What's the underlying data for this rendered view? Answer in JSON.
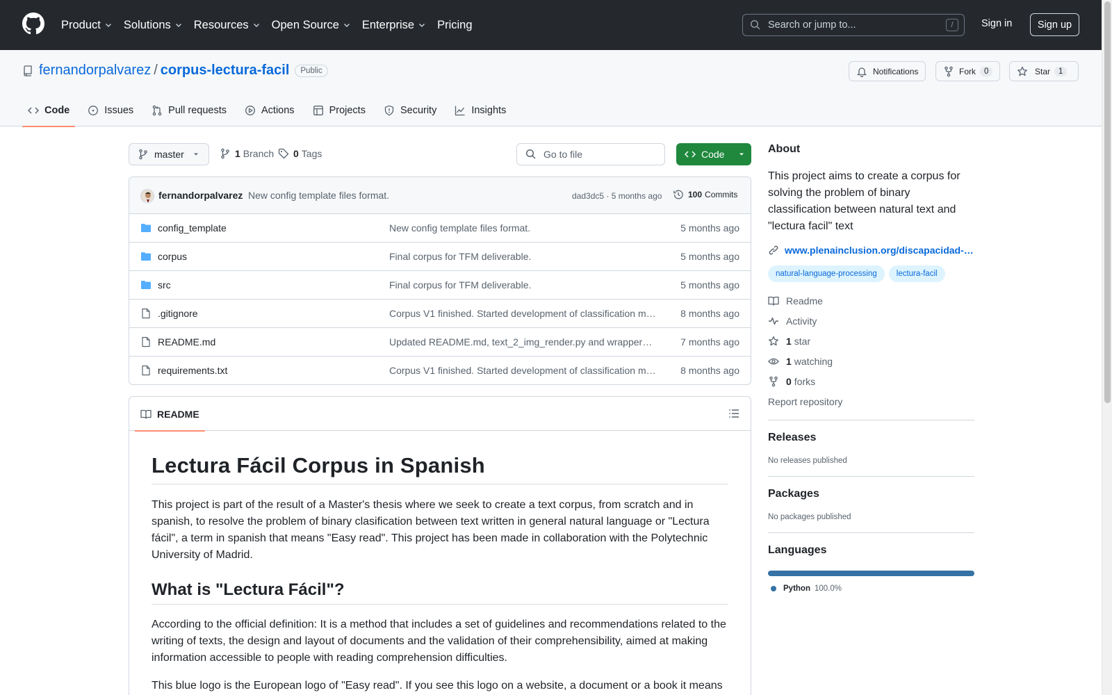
{
  "header": {
    "nav": [
      {
        "label": "Product",
        "has_chevron": true
      },
      {
        "label": "Solutions",
        "has_chevron": true
      },
      {
        "label": "Resources",
        "has_chevron": true
      },
      {
        "label": "Open Source",
        "has_chevron": true
      },
      {
        "label": "Enterprise",
        "has_chevron": true
      },
      {
        "label": "Pricing",
        "has_chevron": false
      }
    ],
    "search_placeholder": "Search or jump to...",
    "search_shortcut": "/",
    "signin": "Sign in",
    "signup": "Sign up"
  },
  "repo": {
    "owner": "fernandorpalvarez",
    "separator": "/",
    "name": "corpus-lectura-facil",
    "visibility": "Public",
    "notifications_label": "Notifications",
    "fork_label": "Fork",
    "fork_count": "0",
    "star_label": "Star",
    "star_count": "1",
    "tabs": [
      {
        "label": "Code",
        "icon": "code-icon",
        "active": true
      },
      {
        "label": "Issues",
        "icon": "issue-icon"
      },
      {
        "label": "Pull requests",
        "icon": "pull-request-icon"
      },
      {
        "label": "Actions",
        "icon": "actions-icon"
      },
      {
        "label": "Projects",
        "icon": "projects-icon"
      },
      {
        "label": "Security",
        "icon": "shield-icon"
      },
      {
        "label": "Insights",
        "icon": "graph-icon"
      }
    ]
  },
  "toolbar": {
    "branch": "master",
    "branch_count": "1",
    "branch_label": "Branch",
    "tag_count": "0",
    "tag_label": "Tags",
    "goto_placeholder": "Go to file",
    "code_button": "Code"
  },
  "commit": {
    "author": "fernandorpalvarez",
    "message": "New config template files format.",
    "sha_time": "dad3dc5 · 5 months ago",
    "count": "100",
    "count_label": "Commits"
  },
  "files": [
    {
      "name": "config_template",
      "type": "dir",
      "message": "New config template files format.",
      "age": "5 months ago"
    },
    {
      "name": "corpus",
      "type": "dir",
      "message": "Final corpus for TFM deliverable.",
      "age": "5 months ago"
    },
    {
      "name": "src",
      "type": "dir",
      "message": "Final corpus for TFM deliverable.",
      "age": "5 months ago"
    },
    {
      "name": ".gitignore",
      "type": "file",
      "message": "Corpus V1 finished. Started development of classification m…",
      "age": "8 months ago"
    },
    {
      "name": "README.md",
      "type": "file",
      "message": "Updated README.md, text_2_img_render.py and wrapper…",
      "age": "7 months ago"
    },
    {
      "name": "requirements.txt",
      "type": "file",
      "message": "Corpus V1 finished. Started development of classification m…",
      "age": "8 months ago"
    }
  ],
  "readme": {
    "tab_label": "README",
    "h1": "Lectura Fácil Corpus in Spanish",
    "p1": "This project is part of the result of a Master's thesis where we seek to create a text corpus, from scratch and in spanish, to resolve the problem of binary clasification between text written in general natural language or \"Lectura fácil\", a term in spanish that means \"Easy read\". This project has been made in collaboration with the Polytechnic University of Madrid.",
    "h2": "What is \"Lectura Fácil\"?",
    "p2": "According to the official definition: It is a method that includes a set of guidelines and recommendations related to the writing of texts, the design and layout of documents and the validation of their comprehensibility, aimed at making information accessible to people with reading comprehension difficulties.",
    "p3": "This blue logo is the European logo of \"Easy read\". If you see this logo on a website, a document or a book it means"
  },
  "sidebar": {
    "about_title": "About",
    "about_text": "This project aims to create a corpus for solving the problem of binary classification between natural text and \"lectura facil\" text",
    "website": "www.plenainclusion.org/discapacidad-…",
    "topics": [
      "natural-language-processing",
      "lectura-facil"
    ],
    "readme_label": "Readme",
    "activity_label": "Activity",
    "stars_count": "1",
    "stars_label": "star",
    "watching_count": "1",
    "watching_label": "watching",
    "forks_count": "0",
    "forks_label": "forks",
    "report_label": "Report repository",
    "releases_title": "Releases",
    "releases_text": "No releases published",
    "packages_title": "Packages",
    "packages_text": "No packages published",
    "languages_title": "Languages",
    "languages": [
      {
        "name": "Python",
        "percent": "100.0%",
        "color": "#3572A5"
      }
    ]
  },
  "colors": {
    "header_bg": "#25292e",
    "link": "#0969da",
    "primary_button": "#1f883d",
    "active_tab_underline": "#fd8c73"
  }
}
